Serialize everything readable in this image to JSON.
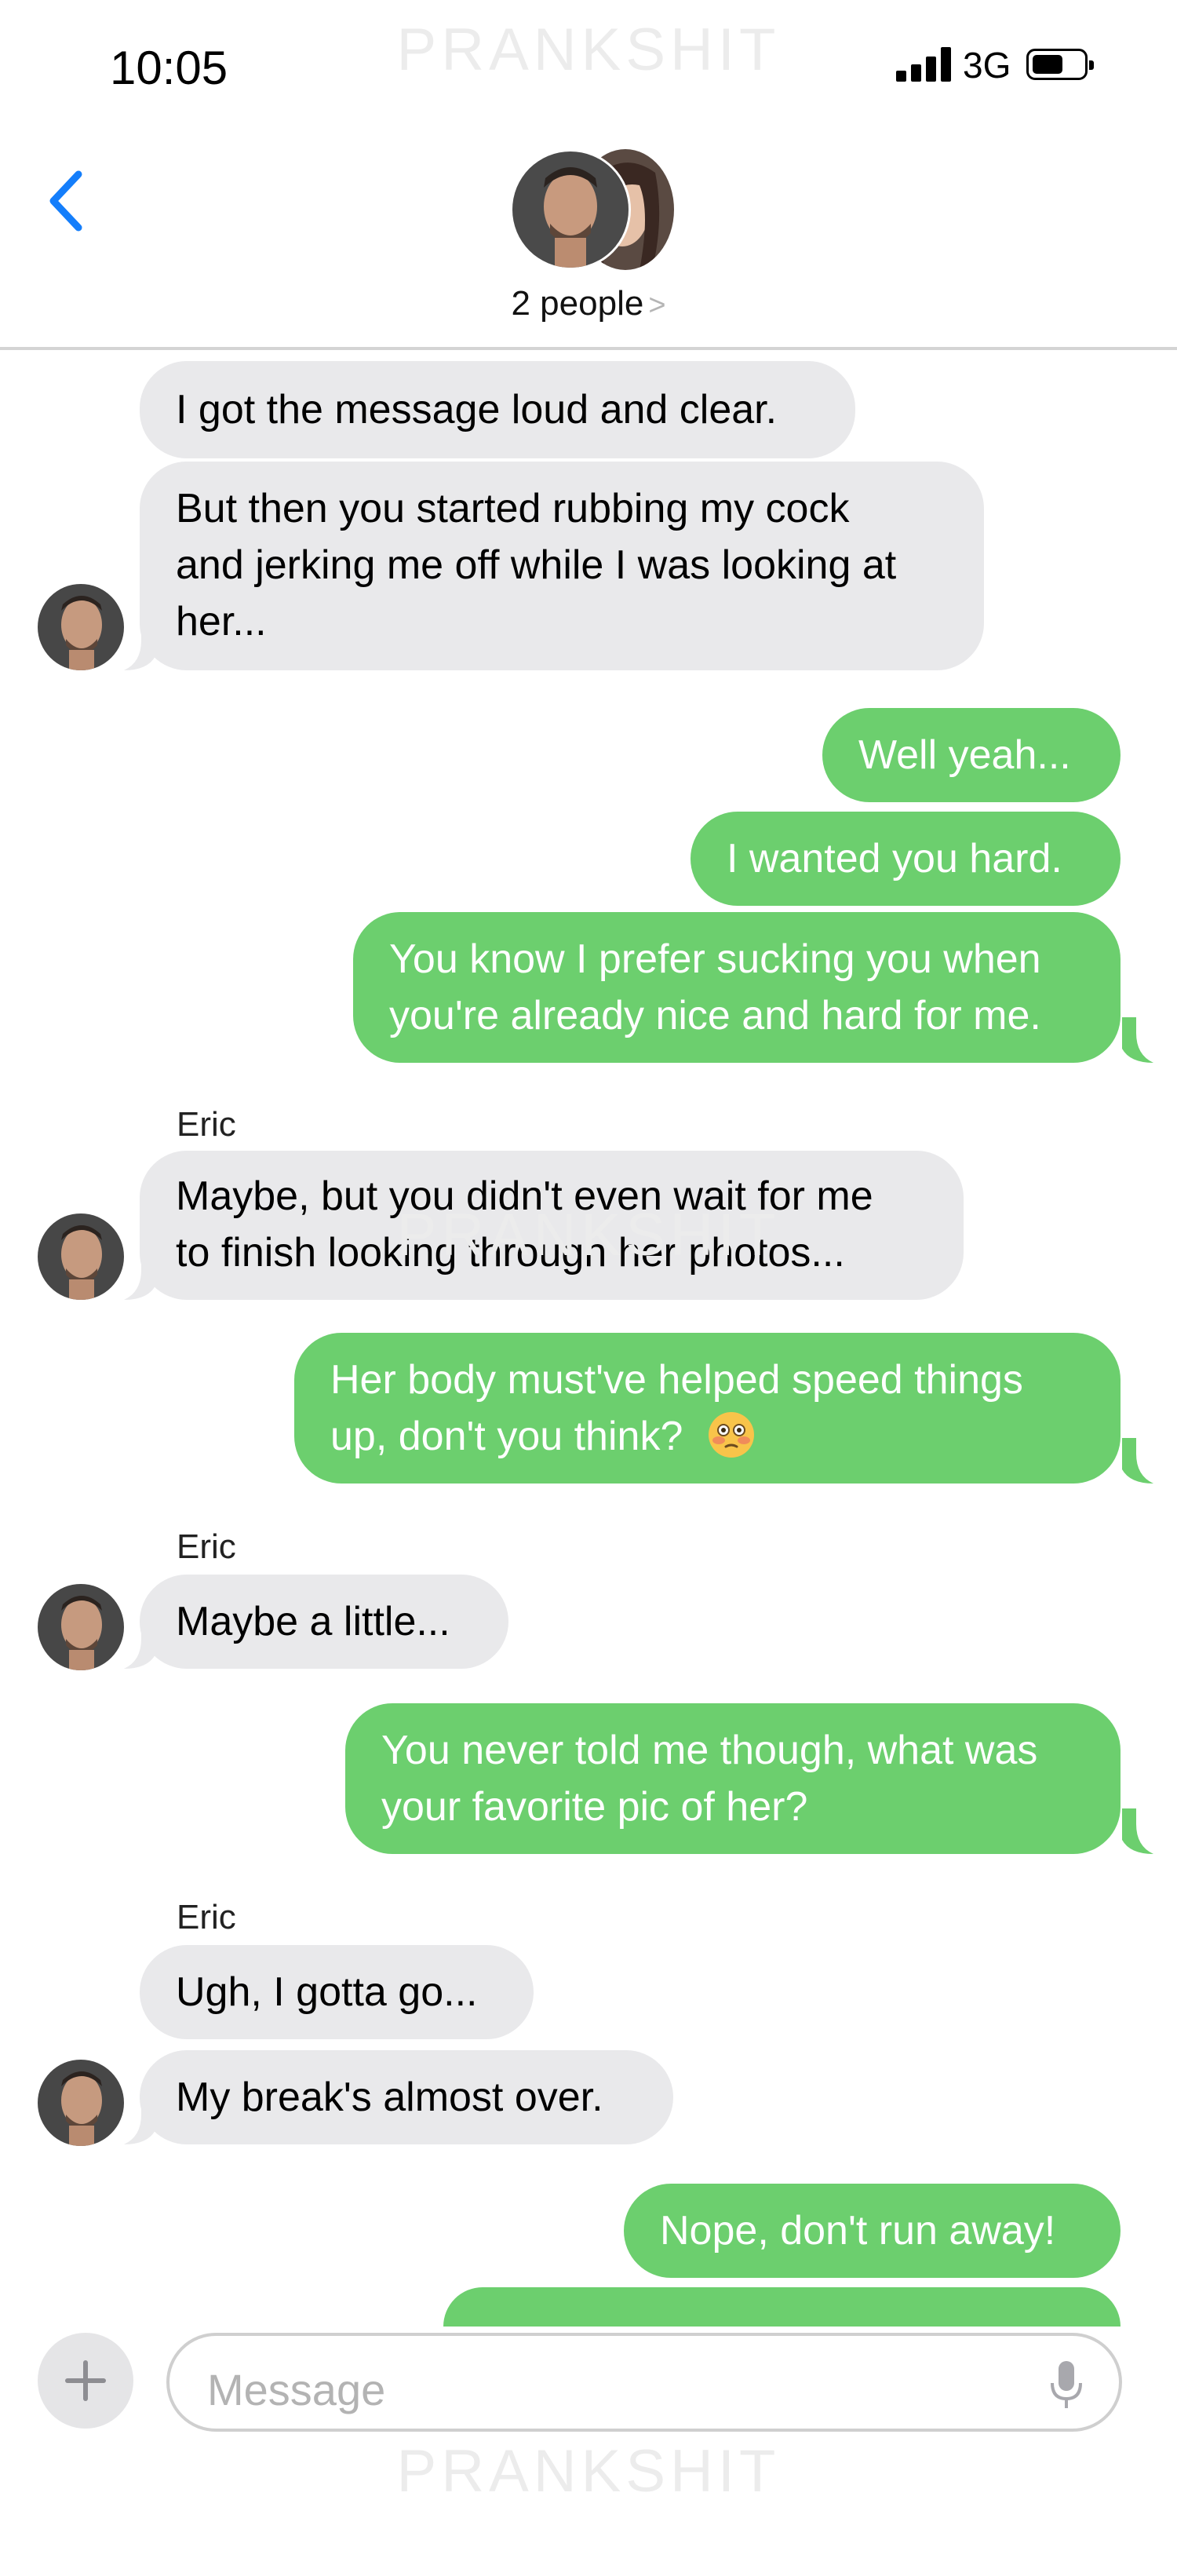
{
  "status_bar": {
    "time": "10:05",
    "network": "3G"
  },
  "watermark": "PRANKSHIT",
  "header": {
    "title": "2 people",
    "chevron": ">"
  },
  "messages": [
    {
      "dir": "in",
      "text": [
        "I got the message loud and clear."
      ]
    },
    {
      "dir": "in",
      "text": [
        "But then you started rubbing my cock",
        "and jerking me off while I was looking at",
        "her..."
      ]
    },
    {
      "dir": "out",
      "text": [
        "Well yeah..."
      ]
    },
    {
      "dir": "out",
      "text": [
        "I wanted you hard."
      ]
    },
    {
      "dir": "out",
      "text": [
        "You know I prefer sucking you when",
        "you're already nice and hard for me."
      ]
    },
    {
      "dir": "in",
      "sender": "Eric",
      "text": [
        "Maybe, but you didn't even wait for me",
        "to finish looking through her photos..."
      ]
    },
    {
      "dir": "out",
      "text": [
        "Her body must've helped speed things",
        "up, don't you think?"
      ]
    },
    {
      "dir": "in",
      "sender": "Eric",
      "text": [
        "Maybe a little..."
      ]
    },
    {
      "dir": "out",
      "text": [
        "You never told me though, what was",
        "your favorite pic of her?"
      ]
    },
    {
      "dir": "in",
      "sender": "Eric",
      "text": [
        "Ugh, I gotta go..."
      ]
    },
    {
      "dir": "in",
      "text": [
        "My break's almost over."
      ]
    },
    {
      "dir": "out",
      "text": [
        "Nope, don't run away!"
      ]
    }
  ],
  "composer": {
    "placeholder": "Message"
  },
  "colors": {
    "incoming": "#e9e9eb",
    "outgoing": "#6ccf6e",
    "accent": "#147efb"
  },
  "icons": {
    "back": "chevron-left-icon",
    "add": "plus-icon",
    "mic": "microphone-icon",
    "emoji": "flushed-face-emoji"
  }
}
